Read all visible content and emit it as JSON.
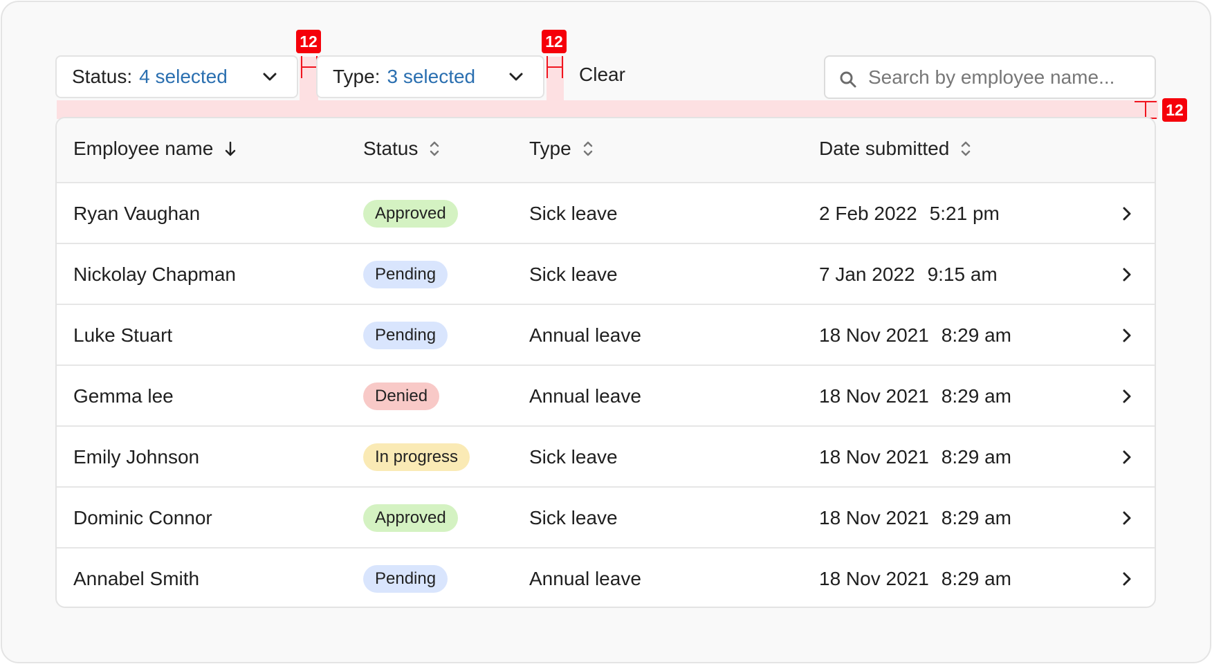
{
  "filters": {
    "status": {
      "label": "Status:",
      "value": "4 selected"
    },
    "type": {
      "label": "Type:",
      "value": "3 selected"
    },
    "clear_label": "Clear"
  },
  "search": {
    "placeholder": "Search by employee name...",
    "value": ""
  },
  "annotations": {
    "gap_label": "12"
  },
  "table": {
    "columns": [
      {
        "label": "Employee name",
        "sort": "desc"
      },
      {
        "label": "Status",
        "sort": "none"
      },
      {
        "label": "Type",
        "sort": "none"
      },
      {
        "label": "Date submitted",
        "sort": "none"
      }
    ],
    "rows": [
      {
        "name": "Ryan Vaughan",
        "status": "Approved",
        "type": "Sick leave",
        "date": "2 Feb 2022",
        "time": "5:21 pm"
      },
      {
        "name": "Nickolay Chapman",
        "status": "Pending",
        "type": "Sick leave",
        "date": "7 Jan 2022",
        "time": "9:15 am"
      },
      {
        "name": "Luke Stuart",
        "status": "Pending",
        "type": "Annual leave",
        "date": "18 Nov 2021",
        "time": "8:29 am"
      },
      {
        "name": "Gemma lee",
        "status": "Denied",
        "type": "Annual leave",
        "date": "18 Nov 2021",
        "time": "8:29 am"
      },
      {
        "name": "Emily Johnson",
        "status": "In progress",
        "type": "Sick leave",
        "date": "18 Nov 2021",
        "time": "8:29 am"
      },
      {
        "name": "Dominic Connor",
        "status": "Approved",
        "type": "Sick leave",
        "date": "18 Nov 2021",
        "time": "8:29 am"
      },
      {
        "name": "Annabel Smith",
        "status": "Pending",
        "type": "Annual leave",
        "date": "18 Nov 2021",
        "time": "8:29 am"
      }
    ]
  },
  "status_colors": {
    "Approved": "#d4f2c2",
    "Pending": "#d9e5fd",
    "Denied": "#f8c9c7",
    "In progress": "#faeab5"
  },
  "colors": {
    "accent": "#2a6fb0",
    "annotation": "#f5000a",
    "spacer": "#fde0e2"
  }
}
